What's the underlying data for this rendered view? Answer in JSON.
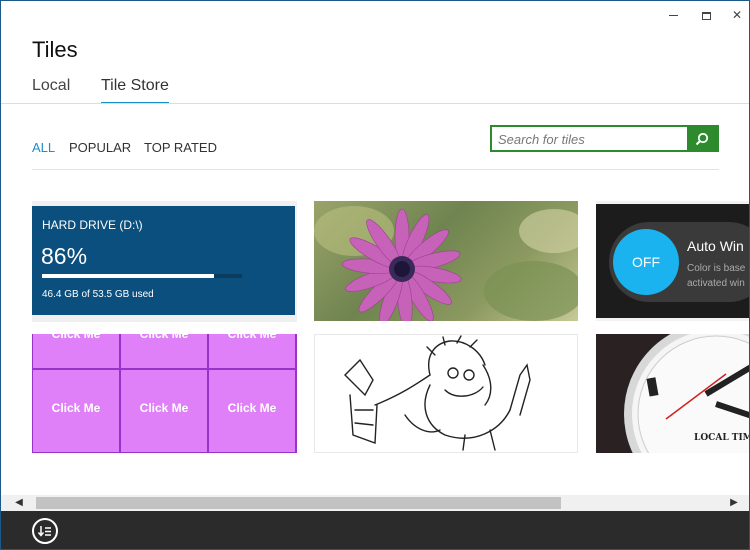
{
  "window": {
    "title": "Tiles",
    "controls": {
      "minimize": "—",
      "maximize": "□",
      "close": "✕"
    }
  },
  "tabs": [
    {
      "label": "Local",
      "active": false
    },
    {
      "label": "Tile Store",
      "active": true
    }
  ],
  "filters": [
    {
      "label": "ALL",
      "active": true
    },
    {
      "label": "POPULAR",
      "active": false
    },
    {
      "label": "TOP RATED",
      "active": false
    }
  ],
  "search": {
    "placeholder": "Search for tiles",
    "value": "",
    "icon": "search-icon"
  },
  "tiles": {
    "hard_drive": {
      "title": "HARD DRIVE (D:\\)",
      "percent": "86%",
      "fill_fraction": 0.86,
      "used": "46.4 GB of 53.5 GB used"
    },
    "flower": {
      "icon": "flower-photo"
    },
    "auto": {
      "toggle": "OFF",
      "title": "Auto Win",
      "desc_line1": "Color is base",
      "desc_line2": "activated win"
    },
    "clickme": {
      "top_row_labels": [
        "Click Me",
        "Click Me",
        "Click Me"
      ],
      "labels": [
        "Click Me",
        "Click Me",
        "Click Me"
      ]
    },
    "sketch": {
      "icon": "cartoon-sketch"
    },
    "clock": {
      "label": "LOCAL TIM"
    }
  },
  "colors": {
    "accent": "#1a8fc8",
    "search_border": "#2d8a2d",
    "hard_drive_bg": "#0a4f7d",
    "toggle_blue": "#1ab2ef",
    "clickme_cell": "#e080f8"
  },
  "appbar": {
    "icon": "sort-icon"
  }
}
